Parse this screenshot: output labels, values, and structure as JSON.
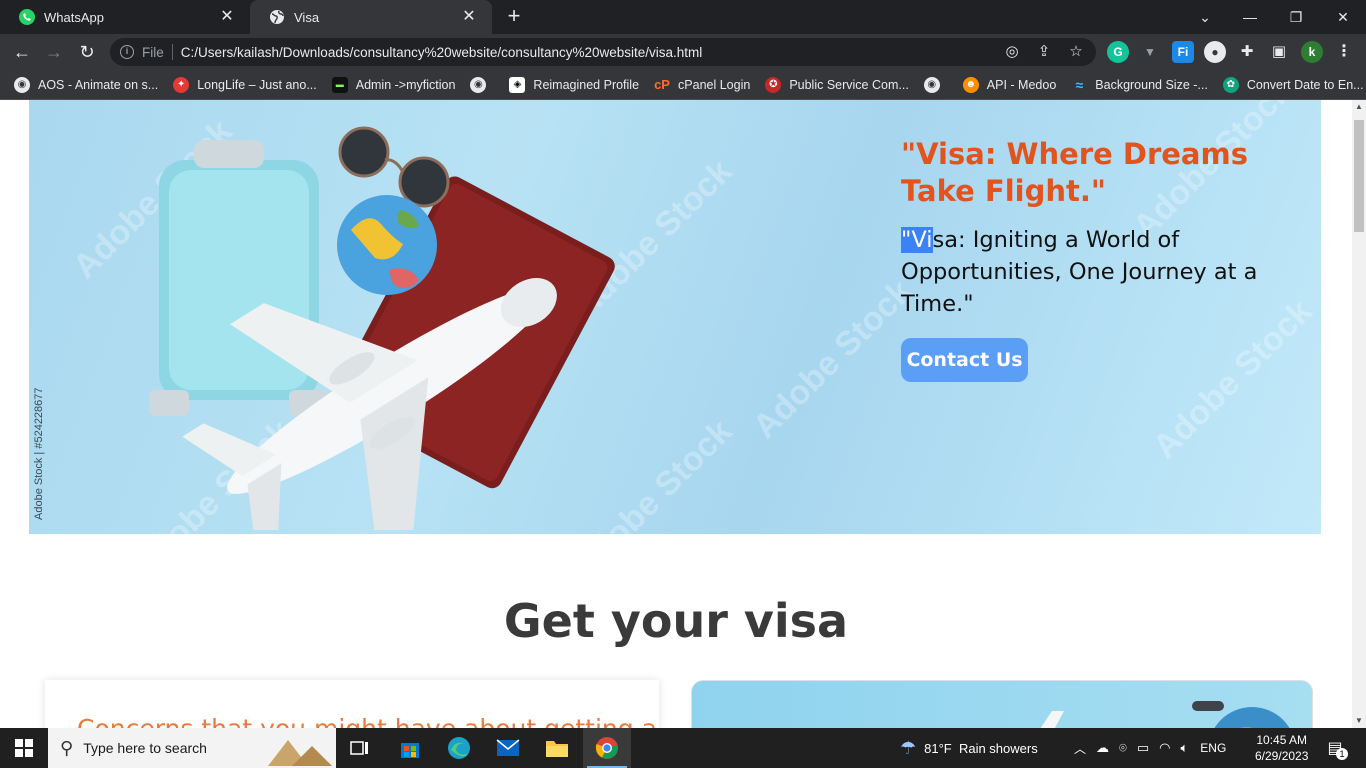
{
  "browser": {
    "tabs": [
      {
        "title": "WhatsApp",
        "icon": "whatsapp-icon",
        "active": false
      },
      {
        "title": "Visa",
        "icon": "globe-icon",
        "active": true
      }
    ],
    "new_tab": "+",
    "window_controls": {
      "tab_search": "⌄",
      "minimize": "—",
      "restore": "❐",
      "close": "✕"
    },
    "address": {
      "scheme": "File",
      "url": "C:/Users/kailash/Downloads/consultancy%20website/consultancy%20website/visa.html"
    },
    "profile_initial": "k",
    "bookmarks": [
      {
        "label": "AOS - Animate on s...",
        "icon_color": "#ffffff"
      },
      {
        "label": "LongLife – Just ano...",
        "icon_color": "#e53935"
      },
      {
        "label": "Admin ->myfiction",
        "icon_color": "#111111"
      },
      {
        "label": "",
        "icon_color": "#ffffff"
      },
      {
        "label": "Reimagined Profile",
        "icon_color": "#ffffff"
      },
      {
        "label": "cPanel Login",
        "icon_color": "#ff6c2c"
      },
      {
        "label": "Public Service Com...",
        "icon_color": "#c62828"
      },
      {
        "label": "",
        "icon_color": "#ffffff"
      },
      {
        "label": "API - Medoo",
        "icon_color": "#ff8f00"
      },
      {
        "label": "Background Size -...",
        "icon_color": "#38bdf8"
      },
      {
        "label": "Convert Date to En...",
        "icon_color": "#10a37f"
      }
    ]
  },
  "page": {
    "hero": {
      "title": "\"Visa: Where Dreams Take Flight.\"",
      "subtitle_selected": "\"Vi",
      "subtitle_rest": "sa: Igniting a World of Opportunities, One Journey at a Time.\"",
      "cta": "Contact Us",
      "stock_id": "Adobe Stock | #524228677",
      "watermark": "Adobe Stock"
    },
    "section_title": "Get your visa",
    "card_heading": "Concerns that you might have about getting a"
  },
  "taskbar": {
    "search_placeholder": "Type here to search",
    "weather": "81°F  Rain showers",
    "language": "ENG",
    "time": "10:45 AM",
    "date": "6/29/2023",
    "notifications": "1"
  },
  "colors": {
    "hero_title": "#e2531d",
    "cta_bg": "#5b9ef5",
    "chrome_dark": "#202124",
    "chrome_toolbar": "#35363a"
  }
}
